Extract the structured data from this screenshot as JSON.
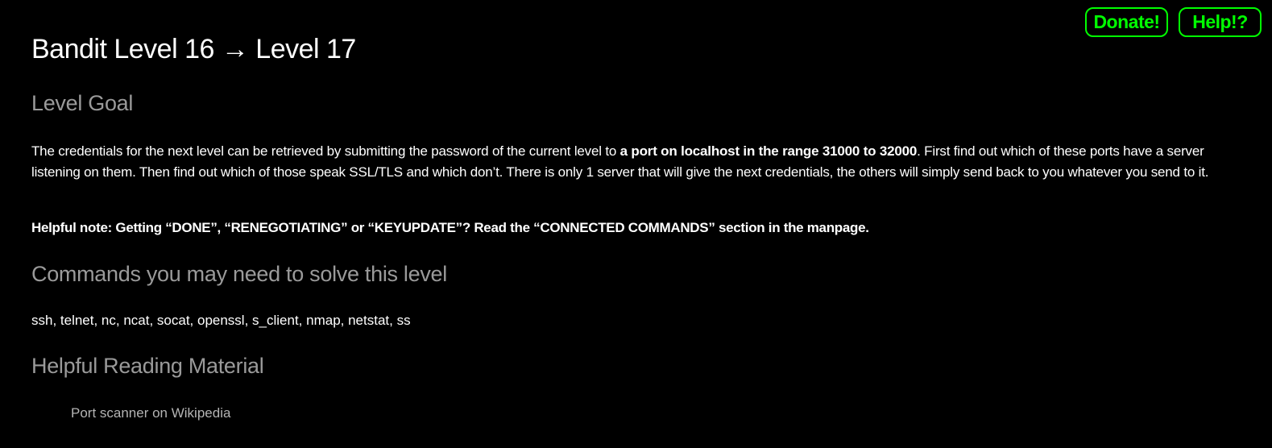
{
  "header": {
    "donate_label": "Donate!",
    "help_label": "Help!?"
  },
  "page": {
    "title": "Bandit Level 16 → Level 17"
  },
  "goal": {
    "heading": "Level Goal",
    "text_before": "The credentials for the next level can be retrieved by submitting the password of the current level to ",
    "text_bold": "a port on localhost in the range 31000 to 32000",
    "text_after": ". First find out which of these ports have a server listening on them. Then find out which of those speak SSL/TLS and which don’t. There is only 1 server that will give the next credentials, the others will simply send back to you whatever you send to it.",
    "note": "Helpful note: Getting “DONE”, “RENEGOTIATING” or “KEYUPDATE”? Read the “CONNECTED COMMANDS” section in the manpage."
  },
  "commands": {
    "heading": "Commands you may need to solve this level",
    "list": "ssh, telnet, nc, ncat, socat, openssl, s_client, nmap, netstat, ss"
  },
  "reading": {
    "heading": "Helpful Reading Material",
    "links": [
      {
        "label": "Port scanner on Wikipedia"
      }
    ]
  },
  "colors": {
    "background": "#000000",
    "accent_green": "#00ff00",
    "heading_gray": "#9a9a9a",
    "link_gray": "#b4b4b4"
  }
}
